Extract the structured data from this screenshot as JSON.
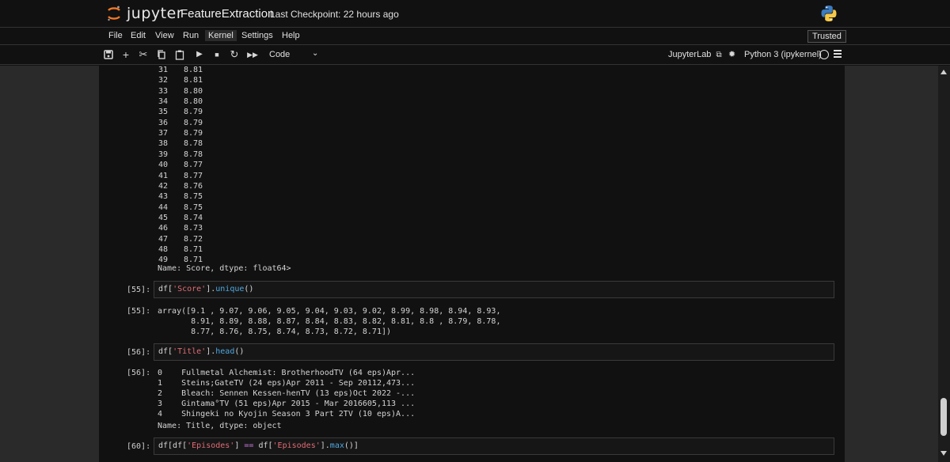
{
  "header": {
    "logo_text": "jupyter",
    "notebook_title": "FeatureExtraction",
    "checkpoint": "Last Checkpoint: 22 hours ago"
  },
  "menu": {
    "items": [
      "File",
      "Edit",
      "View",
      "Run",
      "Kernel",
      "Settings",
      "Help"
    ],
    "active": "Kernel",
    "trusted": "Trusted"
  },
  "toolbar": {
    "icons": [
      "save-icon",
      "add-icon",
      "cut-icon",
      "copy-icon",
      "paste-icon",
      "run-icon",
      "stop-icon",
      "restart-icon",
      "fast-forward-icon"
    ],
    "cell_type": "Code",
    "jupyterlab_link": "JupyterLab",
    "kernel_name": "Python 3 (ipykernel)"
  },
  "series_output": {
    "rows": [
      {
        "idx": "31",
        "val": "8.81"
      },
      {
        "idx": "32",
        "val": "8.81"
      },
      {
        "idx": "33",
        "val": "8.80"
      },
      {
        "idx": "34",
        "val": "8.80"
      },
      {
        "idx": "35",
        "val": "8.79"
      },
      {
        "idx": "36",
        "val": "8.79"
      },
      {
        "idx": "37",
        "val": "8.79"
      },
      {
        "idx": "38",
        "val": "8.78"
      },
      {
        "idx": "39",
        "val": "8.78"
      },
      {
        "idx": "40",
        "val": "8.77"
      },
      {
        "idx": "41",
        "val": "8.77"
      },
      {
        "idx": "42",
        "val": "8.76"
      },
      {
        "idx": "43",
        "val": "8.75"
      },
      {
        "idx": "44",
        "val": "8.75"
      },
      {
        "idx": "45",
        "val": "8.74"
      },
      {
        "idx": "46",
        "val": "8.73"
      },
      {
        "idx": "47",
        "val": "8.72"
      },
      {
        "idx": "48",
        "val": "8.71"
      },
      {
        "idx": "49",
        "val": "8.71"
      }
    ],
    "footer": "Name: Score, dtype: float64>"
  },
  "cells": {
    "c55": {
      "in_prompt": "[55]:",
      "code": {
        "p1": "df[",
        "s1": "'Score'",
        "p2": "].",
        "f1": "unique",
        "p3": "()"
      },
      "out_prompt": "[55]:",
      "output": [
        "array([9.1 , 9.07, 9.06, 9.05, 9.04, 9.03, 9.02, 8.99, 8.98, 8.94, 8.93,",
        "       8.91, 8.89, 8.88, 8.87, 8.84, 8.83, 8.82, 8.81, 8.8 , 8.79, 8.78,",
        "       8.77, 8.76, 8.75, 8.74, 8.73, 8.72, 8.71])"
      ]
    },
    "c56": {
      "in_prompt": "[56]:",
      "code": {
        "p1": "df[",
        "s1": "'Title'",
        "p2": "].",
        "f1": "head",
        "p3": "()"
      },
      "out_prompt": "[56]:",
      "output": [
        "0    Fullmetal Alchemist: BrotherhoodTV (64 eps)Apr...",
        "1    Steins;GateTV (24 eps)Apr 2011 - Sep 20112,473...",
        "2    Bleach: Sennen Kessen-henTV (13 eps)Oct 2022 -...",
        "3    Gintama°TV (51 eps)Apr 2015 - Mar 2016605,113 ...",
        "4    Shingeki no Kyojin Season 3 Part 2TV (10 eps)A...",
        "Name: Title, dtype: object"
      ]
    },
    "c60": {
      "in_prompt": "[60]:",
      "code": {
        "p1": "df[df[",
        "s1": "'Episodes'",
        "p2": "] ",
        "op": "==",
        "p3": " df[",
        "s2": "'Episodes'",
        "p4": "].",
        "f1": "max",
        "p5": "()]"
      }
    }
  },
  "colors": {
    "background": "#111111",
    "gutter": "#2a2a2a",
    "string": "#e06c75",
    "function": "#4fa8e0",
    "operator": "#c678dd"
  }
}
